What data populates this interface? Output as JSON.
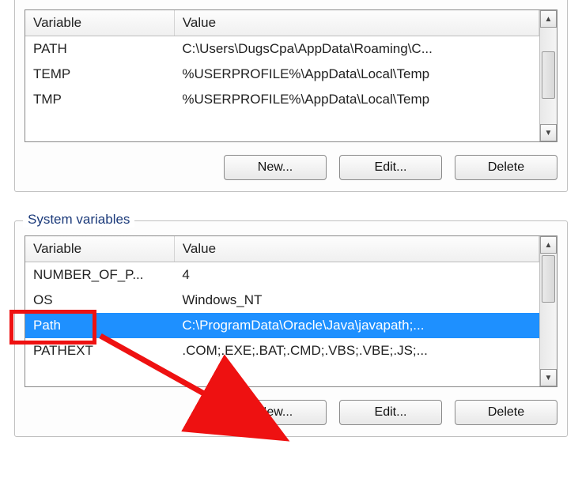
{
  "user_section": {
    "columns": {
      "variable": "Variable",
      "value": "Value"
    },
    "rows": [
      {
        "variable": "PATH",
        "value": "C:\\Users\\DugsCpa\\AppData\\Roaming\\C..."
      },
      {
        "variable": "TEMP",
        "value": "%USERPROFILE%\\AppData\\Local\\Temp"
      },
      {
        "variable": "TMP",
        "value": "%USERPROFILE%\\AppData\\Local\\Temp"
      }
    ],
    "buttons": {
      "new": "New...",
      "edit": "Edit...",
      "delete": "Delete"
    }
  },
  "system_section": {
    "label": "System variables",
    "columns": {
      "variable": "Variable",
      "value": "Value"
    },
    "rows": [
      {
        "variable": "NUMBER_OF_P...",
        "value": "4"
      },
      {
        "variable": "OS",
        "value": "Windows_NT"
      },
      {
        "variable": "Path",
        "value": "C:\\ProgramData\\Oracle\\Java\\javapath;...",
        "selected": true
      },
      {
        "variable": "PATHEXT",
        "value": ".COM;.EXE;.BAT;.CMD;.VBS;.VBE;.JS;..."
      }
    ],
    "buttons": {
      "new": "New...",
      "edit": "Edit...",
      "delete": "Delete"
    }
  }
}
